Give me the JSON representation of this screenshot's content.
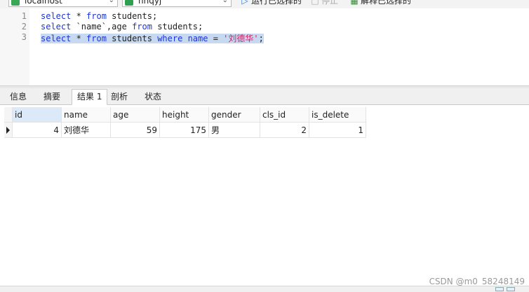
{
  "toolbar": {
    "connection": "localhost",
    "database": "hhqyj",
    "run_selected": "运行已选择的",
    "stop": "停止",
    "explain_selected": "解释已选择的"
  },
  "editor": {
    "lines": [
      {
        "number": "1",
        "code": [
          {
            "t": "select",
            "c": "kw"
          },
          {
            "t": " * ",
            "c": "pl"
          },
          {
            "t": "from",
            "c": "kw"
          },
          {
            "t": " students;",
            "c": "pl"
          }
        ]
      },
      {
        "number": "2",
        "code": [
          {
            "t": "select",
            "c": "kw"
          },
          {
            "t": " `name`,age ",
            "c": "pl"
          },
          {
            "t": "from",
            "c": "kw"
          },
          {
            "t": " students;",
            "c": "pl"
          }
        ]
      },
      {
        "number": "3",
        "code": [
          {
            "t": "select",
            "c": "kw"
          },
          {
            "t": " * ",
            "c": "pl"
          },
          {
            "t": "from",
            "c": "kw"
          },
          {
            "t": " students ",
            "c": "pl"
          },
          {
            "t": "where",
            "c": "kw"
          },
          {
            "t": " ",
            "c": "pl"
          },
          {
            "t": "name",
            "c": "kw"
          },
          {
            "t": " = ",
            "c": "pl"
          },
          {
            "t": "'刘德华'",
            "c": "str"
          },
          {
            "t": ";",
            "c": "pl"
          }
        ],
        "selected": true
      }
    ]
  },
  "tabs": [
    {
      "label": "信息"
    },
    {
      "label": "摘要"
    },
    {
      "label": "结果 1",
      "active": true
    },
    {
      "label": "剖析"
    },
    {
      "label": "状态"
    }
  ],
  "grid": {
    "columns": [
      "id",
      "name",
      "age",
      "height",
      "gender",
      "cls_id",
      "is_delete"
    ],
    "rows": [
      [
        "4",
        "刘德华",
        "59",
        "175",
        "男",
        "2",
        "1"
      ]
    ]
  },
  "watermark": "CSDN @m0_58248149"
}
